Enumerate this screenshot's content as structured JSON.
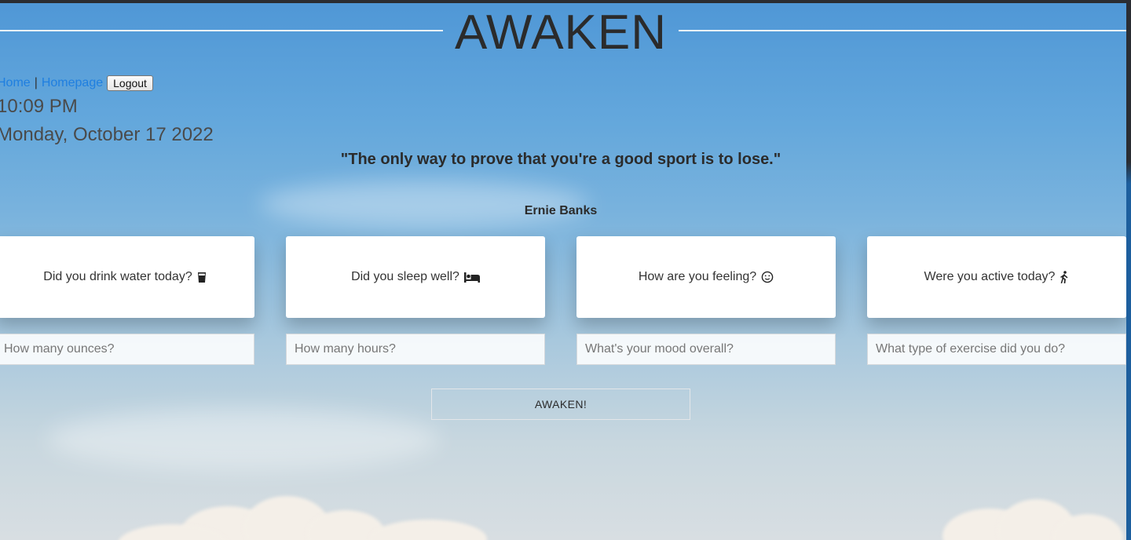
{
  "header": {
    "title": "AWAKEN"
  },
  "nav": {
    "home_label": "Home",
    "separator": "|",
    "homepage_label": "Homepage",
    "logout_label": "Logout"
  },
  "clock": {
    "time": "10:09 PM",
    "date": "Monday, October 17 2022"
  },
  "quote": {
    "text": "\"The only way to prove that you're a good sport is to lose.\"",
    "author": "Ernie Banks"
  },
  "cards": [
    {
      "question": "Did you drink water today?",
      "icon": "glass-icon",
      "placeholder": "How many ounces?"
    },
    {
      "question": "Did you sleep well?",
      "icon": "bed-icon",
      "placeholder": "How many hours?"
    },
    {
      "question": "How are you feeling?",
      "icon": "smile-icon",
      "placeholder": "What's your mood overall?"
    },
    {
      "question": "Were you active today?",
      "icon": "walking-icon",
      "placeholder": "What type of exercise did you do?"
    }
  ],
  "submit": {
    "label": "AWAKEN!"
  },
  "colors": {
    "link": "#1f7fe0",
    "text": "#2b2b2b",
    "sky_top": "#4f97d6",
    "sky_bottom": "#d8dee2"
  }
}
